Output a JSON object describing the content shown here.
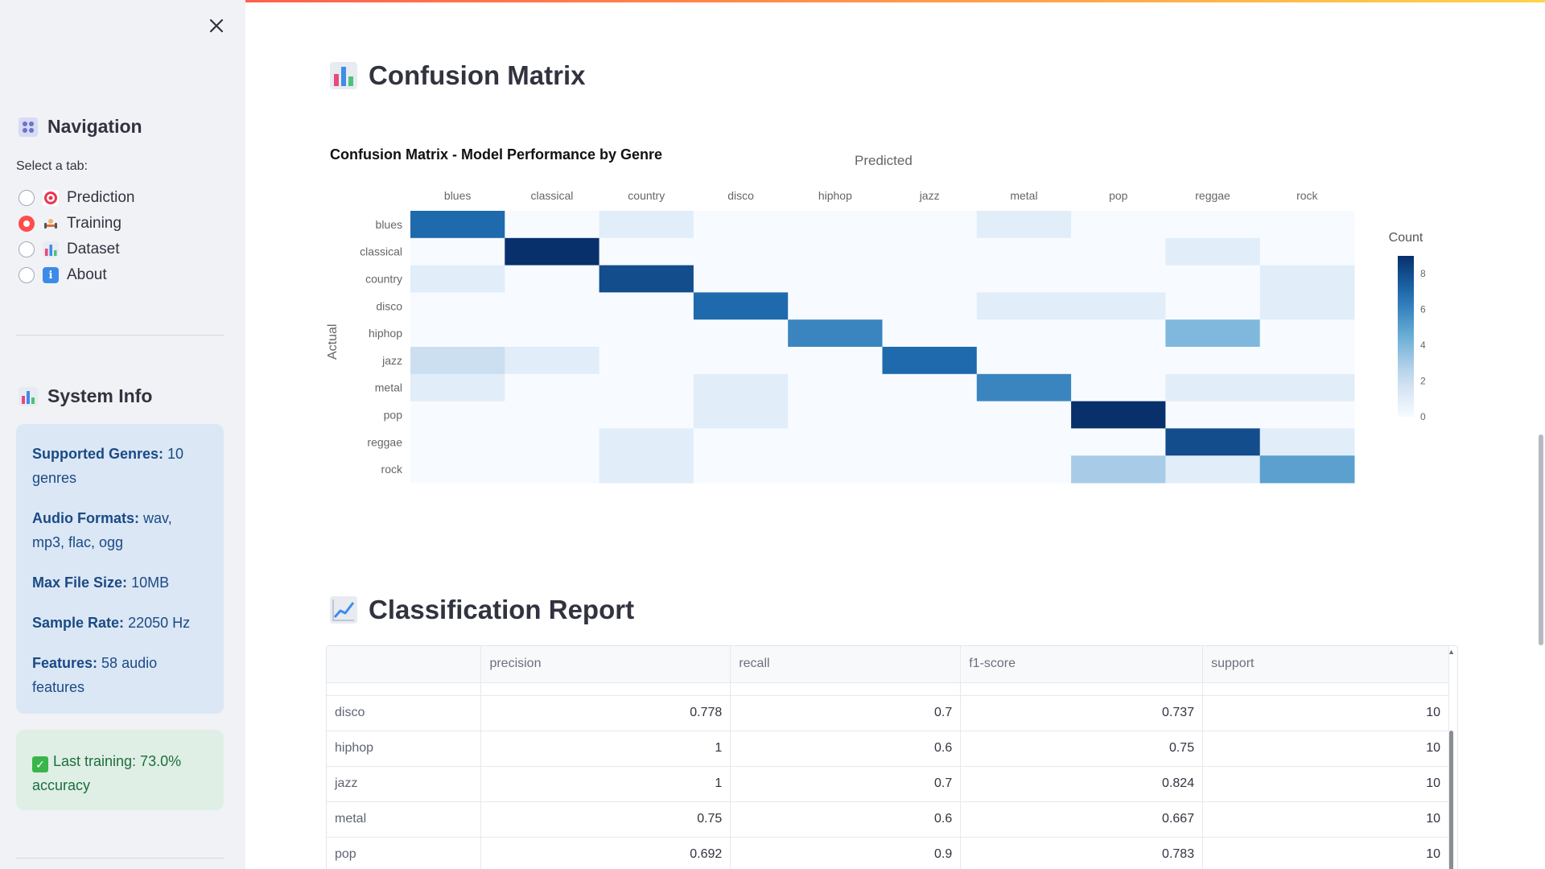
{
  "sidebar": {
    "navigation_title": "Navigation",
    "select_label": "Select a tab:",
    "tabs": [
      {
        "label": "Prediction",
        "icon": "target-icon",
        "checked": false
      },
      {
        "label": "Training",
        "icon": "dumbbell-icon",
        "checked": true
      },
      {
        "label": "Dataset",
        "icon": "bar-chart-icon",
        "checked": false
      },
      {
        "label": "About",
        "icon": "info-icon",
        "checked": false
      }
    ],
    "system_info_title": "System Info",
    "info": [
      {
        "key": "Supported Genres:",
        "value": "10 genres"
      },
      {
        "key": "Audio Formats:",
        "value": "wav, mp3, flac, ogg"
      },
      {
        "key": "Max File Size:",
        "value": "10MB"
      },
      {
        "key": "Sample Rate:",
        "value": "22050 Hz"
      },
      {
        "key": "Features:",
        "value": "58 audio features"
      }
    ],
    "success": "Last training: 73.0% accuracy"
  },
  "main": {
    "confusion_title": "Confusion Matrix",
    "report_title": "Classification Report"
  },
  "chart_data": {
    "type": "heatmap",
    "title": "Confusion Matrix - Model Performance by Genre",
    "xlabel": "Predicted",
    "ylabel": "Actual",
    "x": [
      "blues",
      "classical",
      "country",
      "disco",
      "hiphop",
      "jazz",
      "metal",
      "pop",
      "reggae",
      "rock"
    ],
    "y": [
      "blues",
      "classical",
      "country",
      "disco",
      "hiphop",
      "jazz",
      "metal",
      "pop",
      "reggae",
      "rock"
    ],
    "z": [
      [
        7,
        0,
        1,
        0,
        0,
        0,
        1,
        0,
        0,
        0
      ],
      [
        0,
        9,
        0,
        0,
        0,
        0,
        0,
        0,
        1,
        0
      ],
      [
        1,
        0,
        8,
        0,
        0,
        0,
        0,
        0,
        0,
        1
      ],
      [
        0,
        0,
        0,
        7,
        0,
        0,
        1,
        1,
        0,
        1
      ],
      [
        0,
        0,
        0,
        0,
        6,
        0,
        0,
        0,
        4,
        0
      ],
      [
        2,
        1,
        0,
        0,
        0,
        7,
        0,
        0,
        0,
        0
      ],
      [
        1,
        0,
        0,
        1,
        0,
        0,
        6,
        0,
        1,
        1
      ],
      [
        0,
        0,
        0,
        1,
        0,
        0,
        0,
        9,
        0,
        0
      ],
      [
        0,
        0,
        1,
        0,
        0,
        0,
        0,
        0,
        8,
        1
      ],
      [
        0,
        0,
        1,
        0,
        0,
        0,
        0,
        3,
        1,
        5
      ]
    ],
    "colorbar_title": "Count",
    "colorbar_ticks": [
      0,
      2,
      4,
      6,
      8
    ],
    "zmax": 9
  },
  "report": {
    "columns": [
      "",
      "precision",
      "recall",
      "f1-score",
      "support"
    ],
    "rows": [
      {
        "label": "disco",
        "precision": "0.778",
        "recall": "0.7",
        "f1": "0.737",
        "support": "10"
      },
      {
        "label": "hiphop",
        "precision": "1",
        "recall": "0.6",
        "f1": "0.75",
        "support": "10"
      },
      {
        "label": "jazz",
        "precision": "1",
        "recall": "0.7",
        "f1": "0.824",
        "support": "10"
      },
      {
        "label": "metal",
        "precision": "0.75",
        "recall": "0.6",
        "f1": "0.667",
        "support": "10"
      },
      {
        "label": "pop",
        "precision": "0.692",
        "recall": "0.9",
        "f1": "0.783",
        "support": "10"
      }
    ]
  }
}
